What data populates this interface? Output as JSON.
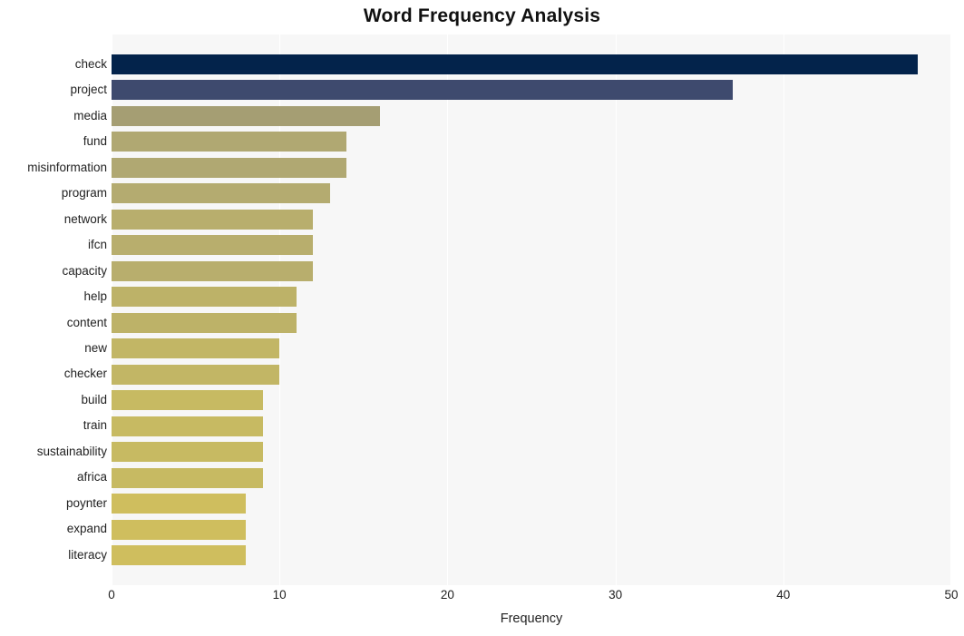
{
  "chart_data": {
    "type": "bar",
    "orientation": "horizontal",
    "title": "Word Frequency Analysis",
    "xlabel": "Frequency",
    "ylabel": "",
    "xlim": [
      0,
      50
    ],
    "xticks": [
      0,
      10,
      20,
      30,
      40,
      50
    ],
    "xtick_labels": [
      "0",
      "10",
      "20",
      "30",
      "40",
      "50"
    ],
    "grid": true,
    "grid_axis": "x",
    "grid_color": "#ffffff",
    "plot_background": "#f7f7f7",
    "figure_background": "#ffffff",
    "legend": null,
    "categories": [
      "check",
      "project",
      "media",
      "fund",
      "misinformation",
      "program",
      "network",
      "ifcn",
      "capacity",
      "help",
      "content",
      "new",
      "checker",
      "build",
      "train",
      "sustainability",
      "africa",
      "poynter",
      "expand",
      "literacy"
    ],
    "values": [
      48,
      37,
      16,
      14,
      14,
      13,
      12,
      12,
      12,
      11,
      11,
      10,
      10,
      9,
      9,
      9,
      9,
      8,
      8,
      8
    ],
    "bar_colors": [
      "#03234b",
      "#3e4a6e",
      "#a59e73",
      "#b0a872",
      "#b0a872",
      "#b4ab70",
      "#b8ae6d",
      "#b8ae6d",
      "#b8ae6d",
      "#bdb268",
      "#bdb268",
      "#c2b665",
      "#c2b665",
      "#c7ba62",
      "#c7ba62",
      "#c7ba62",
      "#c7ba62",
      "#cfbe5e",
      "#cfbe5e",
      "#cfbe5e"
    ]
  }
}
